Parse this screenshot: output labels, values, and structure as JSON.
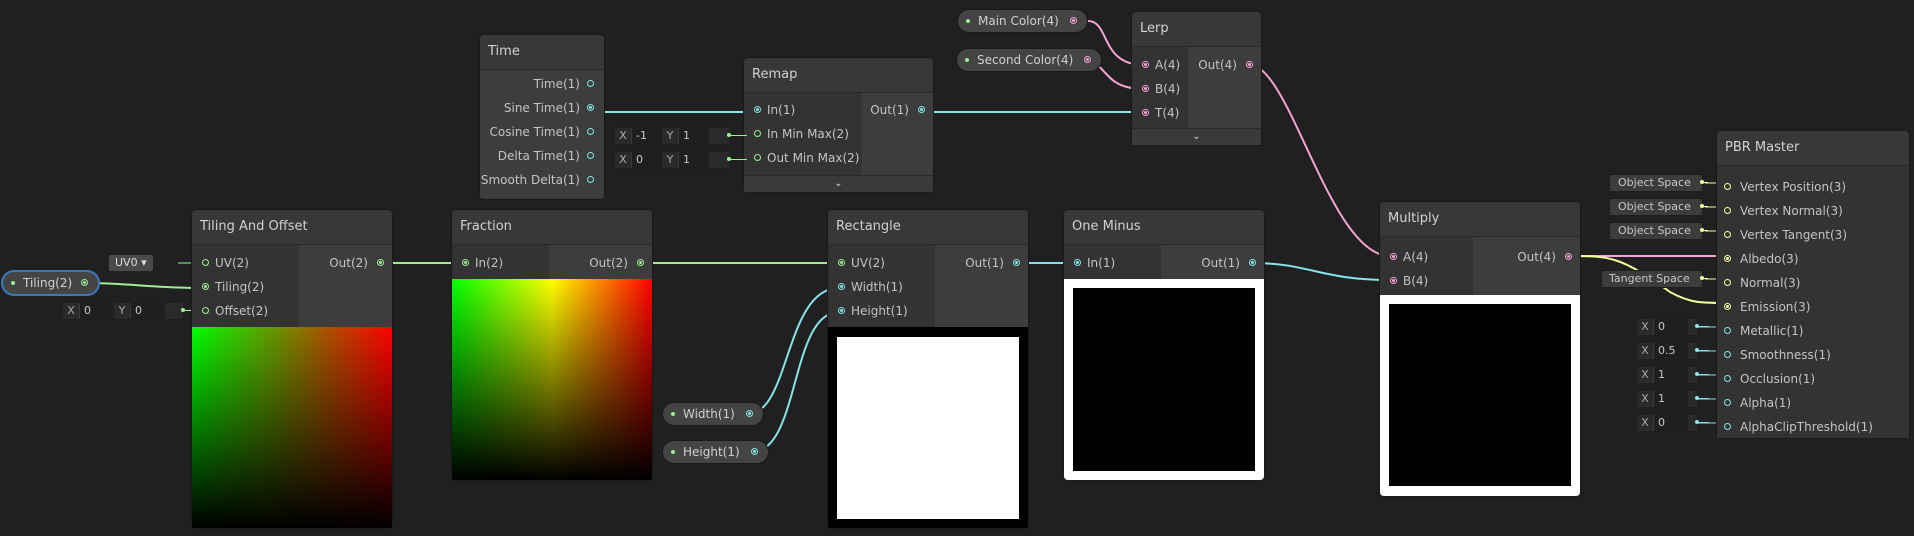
{
  "colors": {
    "vector1": "#84e4e7",
    "vector2": "#9aef92",
    "vector3": "#f6ff9a",
    "vector4": "#f5a3d6",
    "background": "#202020",
    "selection": "#3a79bb"
  },
  "properties": {
    "main_color": "Main Color(4)",
    "second_color": "Second Color(4)",
    "tiling": "Tiling(2)",
    "width": "Width(1)",
    "height": "Height(1)"
  },
  "time_node": {
    "title": "Time",
    "outputs": [
      "Time(1)",
      "Sine Time(1)",
      "Cosine Time(1)",
      "Delta Time(1)",
      "Smooth Delta(1)"
    ]
  },
  "remap_node": {
    "title": "Remap",
    "inputs": [
      "In(1)",
      "In Min Max(2)",
      "Out Min Max(2)"
    ],
    "output": "Out(1)",
    "in_min_max": {
      "x_label": "X",
      "x": "-1",
      "y_label": "Y",
      "y": "1"
    },
    "out_min_max": {
      "x_label": "X",
      "x": "0",
      "y_label": "Y",
      "y": "1"
    }
  },
  "lerp_node": {
    "title": "Lerp",
    "inputs": [
      "A(4)",
      "B(4)",
      "T(4)"
    ],
    "output": "Out(4)"
  },
  "tiling_node": {
    "title": "Tiling And Offset",
    "inputs": [
      "UV(2)",
      "Tiling(2)",
      "Offset(2)"
    ],
    "output": "Out(2)",
    "uv_dropdown": "UV0",
    "offset": {
      "x_label": "X",
      "x": "0",
      "y_label": "Y",
      "y": "0"
    }
  },
  "fraction_node": {
    "title": "Fraction",
    "input": "In(2)",
    "output": "Out(2)"
  },
  "rectangle_node": {
    "title": "Rectangle",
    "inputs": [
      "UV(2)",
      "Width(1)",
      "Height(1)"
    ],
    "output": "Out(1)"
  },
  "one_minus_node": {
    "title": "One Minus",
    "input": "In(1)",
    "output": "Out(1)"
  },
  "multiply_node": {
    "title": "Multiply",
    "inputs": [
      "A(4)",
      "B(4)"
    ],
    "output": "Out(4)"
  },
  "pbr_master": {
    "title": "PBR Master",
    "inputs": [
      "Vertex Position(3)",
      "Vertex Normal(3)",
      "Vertex Tangent(3)",
      "Albedo(3)",
      "Normal(3)",
      "Emission(3)",
      "Metallic(1)",
      "Smoothness(1)",
      "Occlusion(1)",
      "Alpha(1)",
      "AlphaClipThreshold(1)"
    ],
    "space_labels": [
      "Object Space",
      "Object Space",
      "Object Space",
      "Tangent Space"
    ],
    "defaults": [
      {
        "label": "X",
        "value": "0"
      },
      {
        "label": "X",
        "value": "0.5"
      },
      {
        "label": "X",
        "value": "1"
      },
      {
        "label": "X",
        "value": "1"
      },
      {
        "label": "X",
        "value": "0"
      }
    ]
  }
}
